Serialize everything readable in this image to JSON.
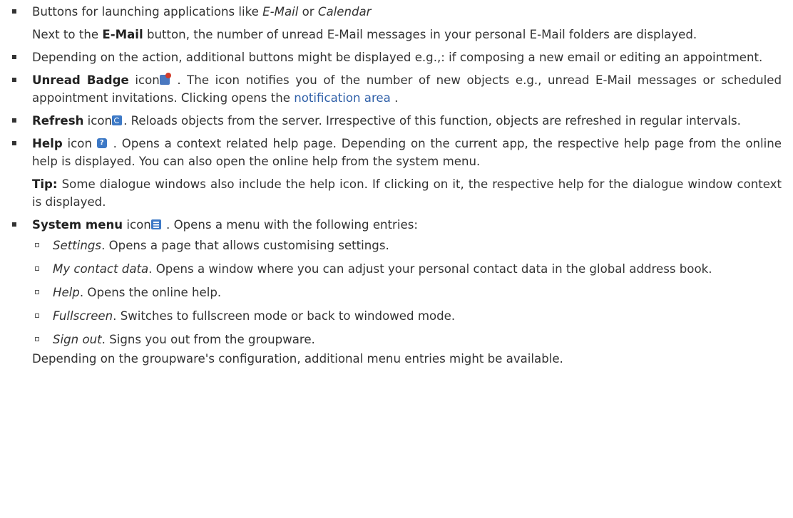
{
  "items": {
    "buttons": {
      "text_a": "Buttons for launching applications like ",
      "em_email": "E-Mail",
      "text_b": " or ",
      "em_calendar": "Calendar",
      "sub_a": "Next to the ",
      "sub_bold": "E-Mail",
      "sub_b": " button, the number of unread E-Mail messages in your personal E-Mail folders are displayed."
    },
    "additional": {
      "text": "Depending on the action, additional buttons might be displayed e.g.,: if composing a new email or editing an appointment."
    },
    "badge": {
      "bold": "Unread Badge",
      "text_a": " icon",
      "text_b": " . The icon notifies you of the number of new objects e.g., unread E-Mail messages or scheduled appointment invitations. Clicking opens the ",
      "link": "notification area",
      "text_c": " ."
    },
    "refresh": {
      "bold": "Refresh",
      "text_a": " icon",
      "text_b": ". Reloads objects from the server. Irrespective of this function, objects are refreshed in regular intervals."
    },
    "help": {
      "bold": "Help",
      "text_a": " icon ",
      "text_b": " . Opens a context related help page. Depending on the current app, the respective help page from the online help is displayed. You can also open the online help from the system menu.",
      "tip_bold": "Tip:",
      "tip_text": " Some dialogue windows also include the help icon. If clicking on it, the respective help for the dialogue window context is displayed."
    },
    "system": {
      "bold": "System menu",
      "text_a": " icon",
      "text_b": " . Opens a menu with the following entries:",
      "entries": [
        {
          "em": "Settings",
          "text": ". Opens a page that allows customising settings."
        },
        {
          "em": "My contact data",
          "text": ". Opens a window where you can adjust your personal contact data in the global address book."
        },
        {
          "em": "Help",
          "text": ". Opens the online help."
        },
        {
          "em": "Fullscreen",
          "text": ". Switches to fullscreen mode or back to windowed mode."
        },
        {
          "em": "Sign out",
          "text": ". Signs you out from the groupware."
        }
      ]
    }
  },
  "footer": "Depending on the groupware's configuration, additional menu entries might be available.",
  "icons": {
    "badge": "unread-badge-icon",
    "refresh": "refresh-icon",
    "help": "help-icon",
    "menu": "system-menu-icon"
  },
  "colors": {
    "text": "#333333",
    "link": "#2e5fa8",
    "icon_blue": "#3d79c6",
    "badge_red": "#d13b2b"
  }
}
